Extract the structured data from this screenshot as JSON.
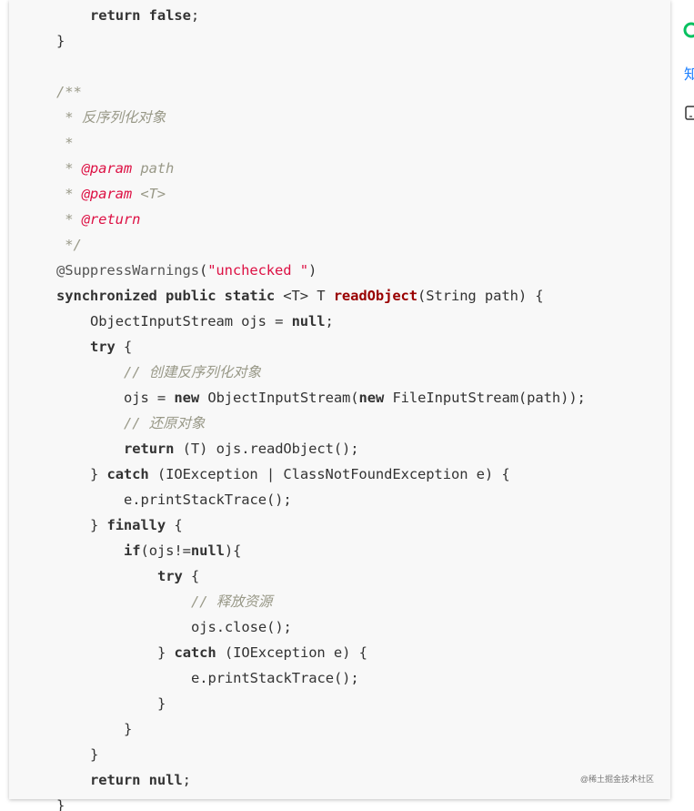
{
  "code": {
    "lines": [
      {
        "indent": 1,
        "tokens": [
          {
            "t": "kw",
            "v": "return"
          },
          {
            "t": "",
            "v": " "
          },
          {
            "t": "kw",
            "v": "false"
          },
          {
            "t": "",
            "v": ";"
          }
        ]
      },
      {
        "indent": 0,
        "tokens": [
          {
            "t": "",
            "v": "}"
          }
        ]
      },
      {
        "indent": 0,
        "tokens": []
      },
      {
        "indent": 0,
        "tokens": [
          {
            "t": "cm",
            "v": "/**"
          }
        ]
      },
      {
        "indent": 0,
        "tokens": [
          {
            "t": "cm",
            "v": " * 反序列化对象"
          }
        ]
      },
      {
        "indent": 0,
        "tokens": [
          {
            "t": "cm",
            "v": " *"
          }
        ]
      },
      {
        "indent": 0,
        "tokens": [
          {
            "t": "cm",
            "v": " * "
          },
          {
            "t": "tag",
            "v": "@param"
          },
          {
            "t": "cm",
            "v": " path"
          }
        ]
      },
      {
        "indent": 0,
        "tokens": [
          {
            "t": "cm",
            "v": " * "
          },
          {
            "t": "tag",
            "v": "@param"
          },
          {
            "t": "cm",
            "v": " <T>"
          }
        ]
      },
      {
        "indent": 0,
        "tokens": [
          {
            "t": "cm",
            "v": " * "
          },
          {
            "t": "tag",
            "v": "@return"
          }
        ]
      },
      {
        "indent": 0,
        "tokens": [
          {
            "t": "cm",
            "v": " */"
          }
        ]
      },
      {
        "indent": 0,
        "tokens": [
          {
            "t": "ann",
            "v": "@SuppressWarnings"
          },
          {
            "t": "",
            "v": "("
          },
          {
            "t": "str",
            "v": "\"unchecked \""
          },
          {
            "t": "",
            "v": ")"
          }
        ]
      },
      {
        "indent": 0,
        "tokens": [
          {
            "t": "kw",
            "v": "synchronized"
          },
          {
            "t": "",
            "v": " "
          },
          {
            "t": "kw",
            "v": "public"
          },
          {
            "t": "",
            "v": " "
          },
          {
            "t": "kw",
            "v": "static"
          },
          {
            "t": "",
            "v": " <T> T "
          },
          {
            "t": "fn",
            "v": "readObject"
          },
          {
            "t": "",
            "v": "(String path) {"
          }
        ]
      },
      {
        "indent": 1,
        "tokens": [
          {
            "t": "",
            "v": "ObjectInputStream ojs = "
          },
          {
            "t": "kw",
            "v": "null"
          },
          {
            "t": "",
            "v": ";"
          }
        ]
      },
      {
        "indent": 1,
        "tokens": [
          {
            "t": "kw",
            "v": "try"
          },
          {
            "t": "",
            "v": " {"
          }
        ]
      },
      {
        "indent": 2,
        "tokens": [
          {
            "t": "cm",
            "v": "// 创建反序列化对象"
          }
        ]
      },
      {
        "indent": 2,
        "tokens": [
          {
            "t": "",
            "v": "ojs = "
          },
          {
            "t": "kw",
            "v": "new"
          },
          {
            "t": "",
            "v": " ObjectInputStream("
          },
          {
            "t": "kw",
            "v": "new"
          },
          {
            "t": "",
            "v": " FileInputStream(path));"
          }
        ]
      },
      {
        "indent": 2,
        "tokens": [
          {
            "t": "cm",
            "v": "// 还原对象"
          }
        ]
      },
      {
        "indent": 2,
        "tokens": [
          {
            "t": "kw",
            "v": "return"
          },
          {
            "t": "",
            "v": " (T) ojs.readObject();"
          }
        ]
      },
      {
        "indent": 1,
        "tokens": [
          {
            "t": "",
            "v": "} "
          },
          {
            "t": "kw",
            "v": "catch"
          },
          {
            "t": "",
            "v": " (IOException | ClassNotFoundException e) {"
          }
        ]
      },
      {
        "indent": 2,
        "tokens": [
          {
            "t": "",
            "v": "e.printStackTrace();"
          }
        ]
      },
      {
        "indent": 1,
        "tokens": [
          {
            "t": "",
            "v": "} "
          },
          {
            "t": "kw",
            "v": "finally"
          },
          {
            "t": "",
            "v": " {"
          }
        ]
      },
      {
        "indent": 2,
        "tokens": [
          {
            "t": "kw",
            "v": "if"
          },
          {
            "t": "",
            "v": "(ojs!="
          },
          {
            "t": "kw",
            "v": "null"
          },
          {
            "t": "",
            "v": "){"
          }
        ]
      },
      {
        "indent": 3,
        "tokens": [
          {
            "t": "kw",
            "v": "try"
          },
          {
            "t": "",
            "v": " {"
          }
        ]
      },
      {
        "indent": 4,
        "tokens": [
          {
            "t": "cm",
            "v": "// 释放资源"
          }
        ]
      },
      {
        "indent": 4,
        "tokens": [
          {
            "t": "",
            "v": "ojs.close();"
          }
        ]
      },
      {
        "indent": 3,
        "tokens": [
          {
            "t": "",
            "v": "} "
          },
          {
            "t": "kw",
            "v": "catch"
          },
          {
            "t": "",
            "v": " (IOException e) {"
          }
        ]
      },
      {
        "indent": 4,
        "tokens": [
          {
            "t": "",
            "v": "e.printStackTrace();"
          }
        ]
      },
      {
        "indent": 3,
        "tokens": [
          {
            "t": "",
            "v": "}"
          }
        ]
      },
      {
        "indent": 2,
        "tokens": [
          {
            "t": "",
            "v": "}"
          }
        ]
      },
      {
        "indent": 1,
        "tokens": [
          {
            "t": "",
            "v": "}"
          }
        ]
      },
      {
        "indent": 1,
        "tokens": [
          {
            "t": "kw",
            "v": "return"
          },
          {
            "t": "",
            "v": " "
          },
          {
            "t": "kw",
            "v": "null"
          },
          {
            "t": "",
            "v": ";"
          }
        ]
      },
      {
        "indent": 0,
        "tokens": [
          {
            "t": "",
            "v": "}"
          }
        ]
      }
    ]
  },
  "watermark": "@稀土掘金技术社区",
  "sidebar": {
    "partial_text": "知",
    "icons": [
      "wechat-icon",
      "tablet-icon"
    ],
    "colors": {
      "wechat": "#07c160",
      "link": "#1e80ff"
    }
  },
  "colors": {
    "keyword": "#333333",
    "comment": "#999988",
    "string": "#dd1144",
    "function": "#990000",
    "annotation": "#555555",
    "background": "#f8f8f8"
  }
}
